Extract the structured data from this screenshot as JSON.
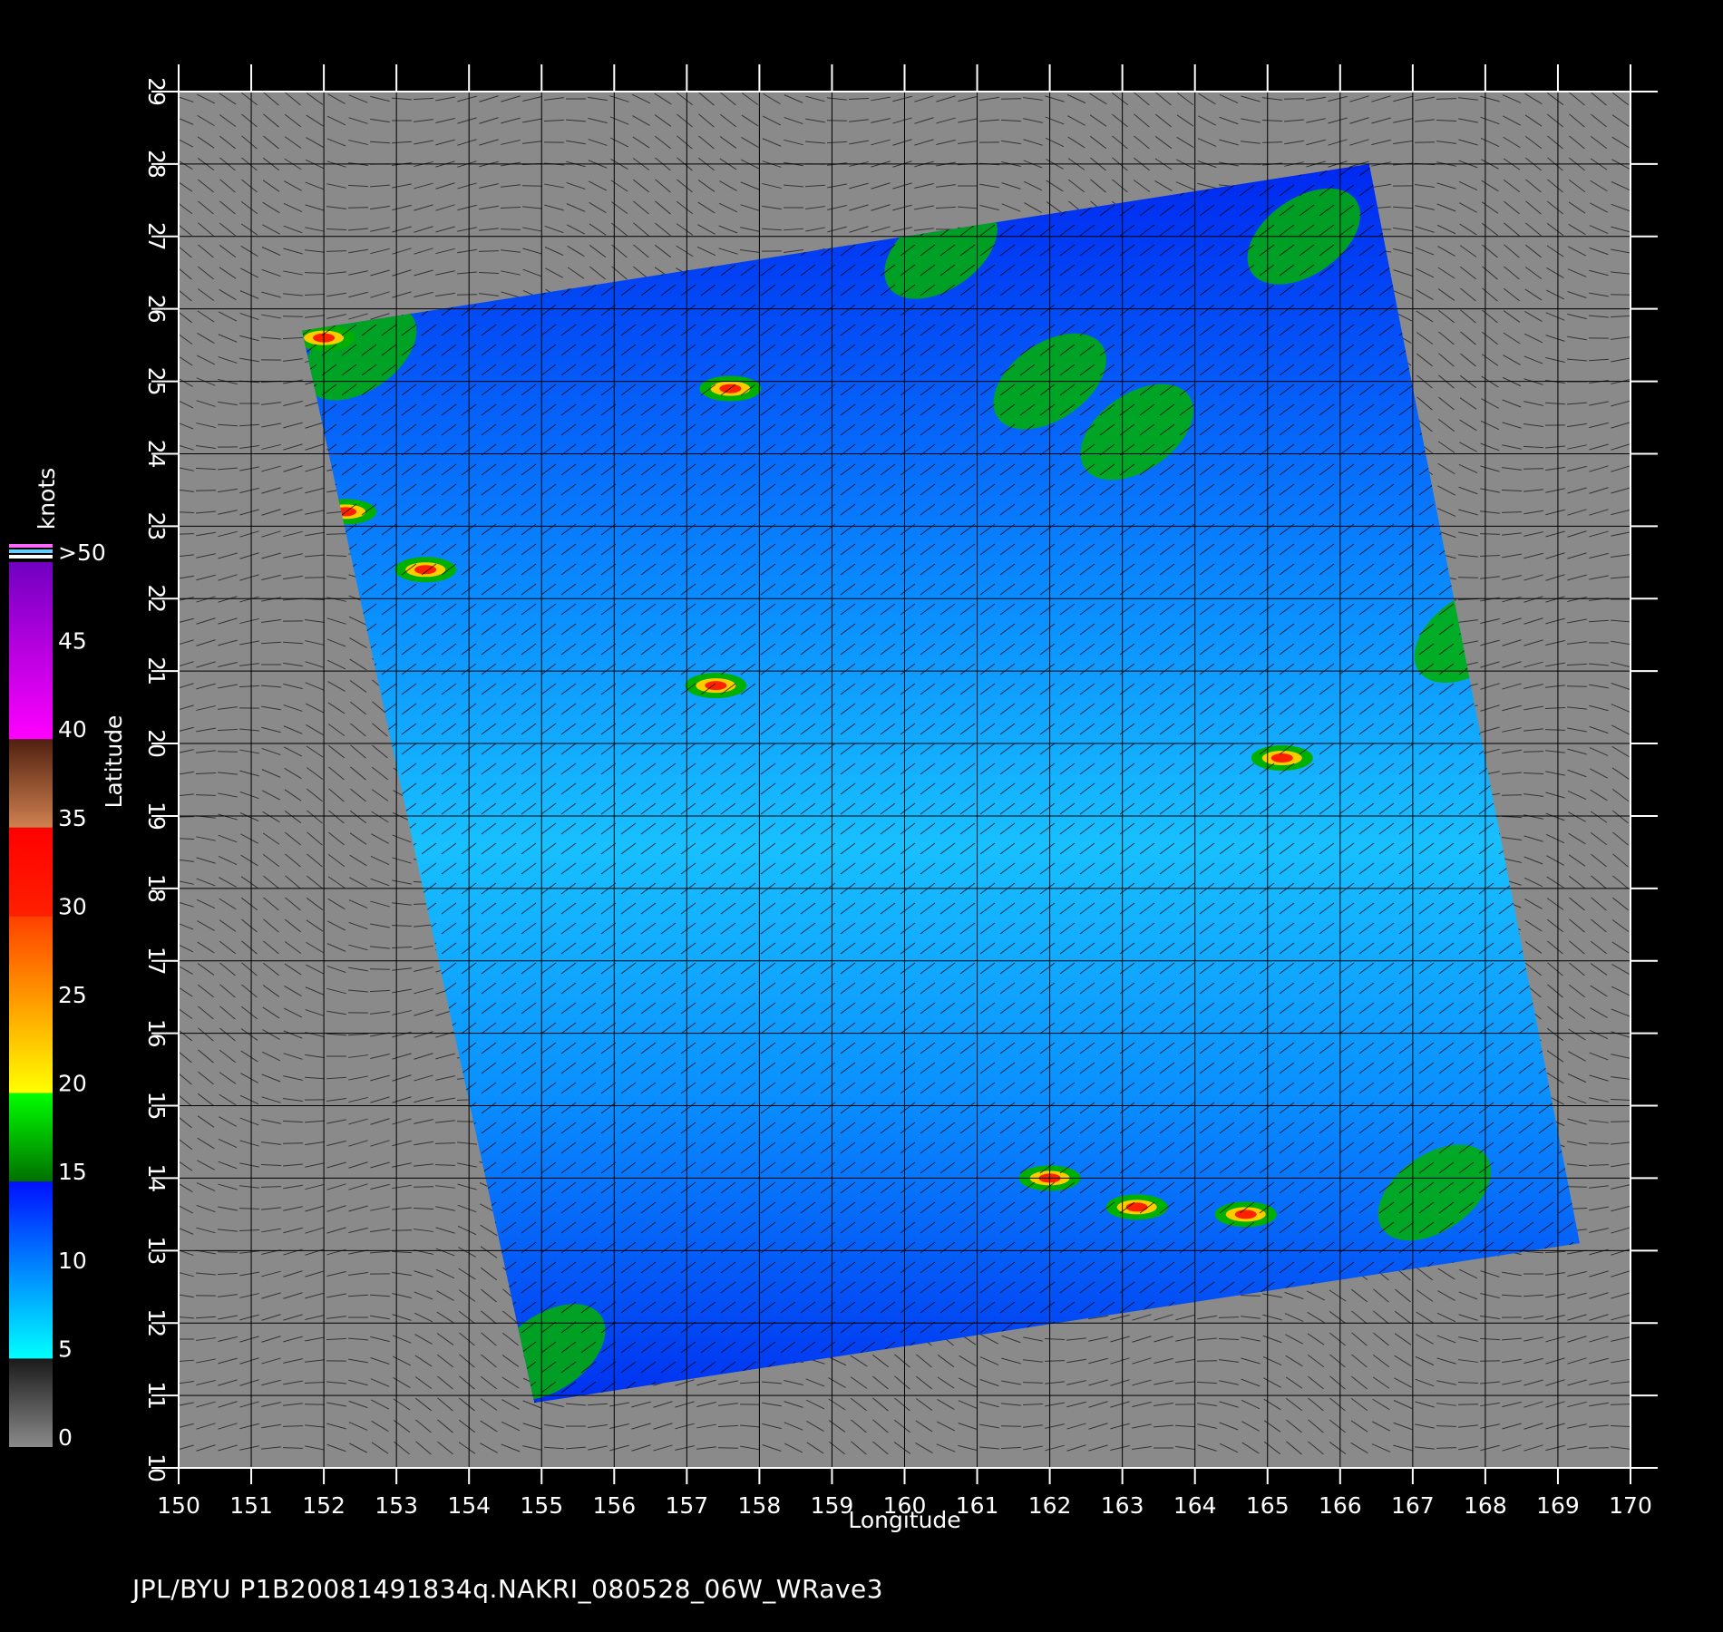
{
  "map": {
    "x_axis": {
      "label": "Longitude",
      "min": 150,
      "max": 170,
      "ticks": [
        150,
        151,
        152,
        153,
        154,
        155,
        156,
        157,
        158,
        159,
        160,
        161,
        162,
        163,
        164,
        165,
        166,
        167,
        168,
        169,
        170
      ]
    },
    "y_axis": {
      "label": "Latitude",
      "min": 10,
      "max": 29,
      "ticks": [
        10,
        11,
        12,
        13,
        14,
        15,
        16,
        17,
        18,
        19,
        20,
        21,
        22,
        23,
        24,
        25,
        26,
        27,
        28,
        29
      ]
    },
    "colorbar": {
      "unit": "knots",
      "tick_labels": [
        "0",
        "5",
        "10",
        "15",
        "20",
        "25",
        "30",
        "35",
        "40",
        "45",
        ">50"
      ],
      "segments": [
        {
          "from": 0,
          "to": 5,
          "colors": [
            "#8a8a8a",
            "#1a1a1a"
          ]
        },
        {
          "from": 5,
          "to": 15,
          "colors": [
            "#00ffff",
            "#0010ff"
          ]
        },
        {
          "from": 15,
          "to": 20,
          "colors": [
            "#007000",
            "#00ff00"
          ]
        },
        {
          "from": 20,
          "to": 30,
          "colors": [
            "#ffff00",
            "#ff4000"
          ]
        },
        {
          "from": 30,
          "to": 35,
          "colors": [
            "#ff2000",
            "#ff0000"
          ]
        },
        {
          "from": 35,
          "to": 40,
          "colors": [
            "#d08050",
            "#502010"
          ]
        },
        {
          "from": 40,
          "to": 50,
          "colors": [
            "#ff00ff",
            "#7000c0"
          ]
        }
      ],
      "colors": {
        "background": "#8a8a8a",
        "swath_dark": "#0020ff",
        "swath_light": "#00c8ff",
        "land_green": "#00b000",
        "high_wind": "#ff2000"
      }
    },
    "swath_corners_lonlat": [
      [
        151.7,
        25.7
      ],
      [
        166.4,
        28.0
      ],
      [
        169.3,
        13.1
      ],
      [
        154.9,
        10.9
      ]
    ],
    "features": [
      {
        "type": "green",
        "lon": 152.5,
        "lat": 25.4
      },
      {
        "type": "high",
        "lon": 152.0,
        "lat": 25.6
      },
      {
        "type": "high",
        "lon": 152.3,
        "lat": 23.2
      },
      {
        "type": "high",
        "lon": 153.4,
        "lat": 22.4
      },
      {
        "type": "high",
        "lon": 157.6,
        "lat": 24.9
      },
      {
        "type": "high",
        "lon": 157.4,
        "lat": 20.8
      },
      {
        "type": "green",
        "lon": 162.0,
        "lat": 25.0
      },
      {
        "type": "green",
        "lon": 163.2,
        "lat": 24.3
      },
      {
        "type": "green",
        "lon": 165.5,
        "lat": 27.0
      },
      {
        "type": "green",
        "lon": 160.5,
        "lat": 26.8
      },
      {
        "type": "green",
        "lon": 167.8,
        "lat": 21.5
      },
      {
        "type": "green",
        "lon": 167.3,
        "lat": 13.8
      },
      {
        "type": "green",
        "lon": 155.1,
        "lat": 11.6
      },
      {
        "type": "high",
        "lon": 162.0,
        "lat": 14.0
      },
      {
        "type": "high",
        "lon": 163.2,
        "lat": 13.6
      },
      {
        "type": "high",
        "lon": 164.7,
        "lat": 13.5
      },
      {
        "type": "high",
        "lon": 165.2,
        "lat": 19.8
      }
    ]
  },
  "footer": {
    "text": "JPL/BYU  P1B20081491834q.NAKRI_080528_06W_WRave3"
  }
}
